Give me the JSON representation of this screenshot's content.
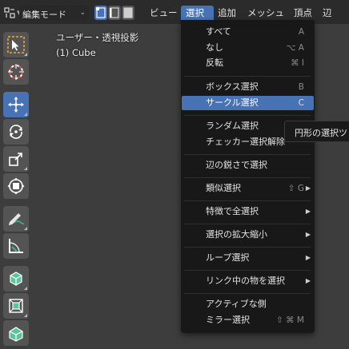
{
  "header": {
    "editor_type_icon": "editor-type-icon",
    "mode": "編集モード",
    "select_modes": [
      "vertex-select-icon",
      "edge-select-icon",
      "face-select-icon"
    ],
    "menus": [
      "ビュー",
      "選択",
      "追加",
      "メッシュ",
      "頂点",
      "辺"
    ],
    "active_menu": "選択"
  },
  "toolbar": {
    "tools": [
      {
        "icon": "select-box-icon",
        "active": false
      },
      {
        "icon": "cursor-icon",
        "active": false
      },
      {
        "icon": "move-icon",
        "active": true
      },
      {
        "icon": "rotate-icon",
        "active": false
      },
      {
        "icon": "scale-icon",
        "active": false
      },
      {
        "icon": "transform-icon",
        "active": false
      },
      {
        "icon": "annotate-icon",
        "active": false
      },
      {
        "icon": "measure-icon",
        "active": false
      },
      {
        "icon": "add-cube-icon",
        "active": false
      },
      {
        "icon": "extrude-region-icon",
        "active": false
      },
      {
        "icon": "inset-faces-icon",
        "active": false
      }
    ],
    "colors": {
      "active": "#4772b3",
      "inactive": "#545454"
    }
  },
  "viewport": {
    "title": "ユーザー・透視投影",
    "object": "(1) Cube"
  },
  "select_menu": {
    "groups": [
      [
        {
          "label": "すべて",
          "shortcut": "A"
        },
        {
          "label": "なし",
          "shortcut": "⌥ A"
        },
        {
          "label": "反転",
          "shortcut": "⌘ I"
        }
      ],
      [
        {
          "label": "ボックス選択",
          "shortcut": "B"
        },
        {
          "label": "サークル選択",
          "shortcut": "C",
          "highlighted": true
        }
      ],
      [
        {
          "label": "ランダム選択",
          "shortcut": ""
        },
        {
          "label": "チェッカー選択解除",
          "shortcut": ""
        }
      ],
      [
        {
          "label": "辺の鋭さで選択",
          "shortcut": ""
        }
      ],
      [
        {
          "label": "類似選択",
          "shortcut": "⇧ G",
          "submenu": true
        }
      ],
      [
        {
          "label": "特徴で全選択",
          "shortcut": "",
          "submenu": true
        }
      ],
      [
        {
          "label": "選択の拡大縮小",
          "shortcut": "",
          "submenu": true
        }
      ],
      [
        {
          "label": "ループ選択",
          "shortcut": "",
          "submenu": true
        }
      ],
      [
        {
          "label": "リンク中の物を選択",
          "shortcut": "",
          "submenu": true
        }
      ],
      [
        {
          "label": "アクティブな側",
          "shortcut": ""
        },
        {
          "label": "ミラー選択",
          "shortcut": "⇧ ⌘ M"
        }
      ]
    ],
    "highlight_color": "#4772b3"
  },
  "tooltip": {
    "text": "円形の選択ツ"
  }
}
